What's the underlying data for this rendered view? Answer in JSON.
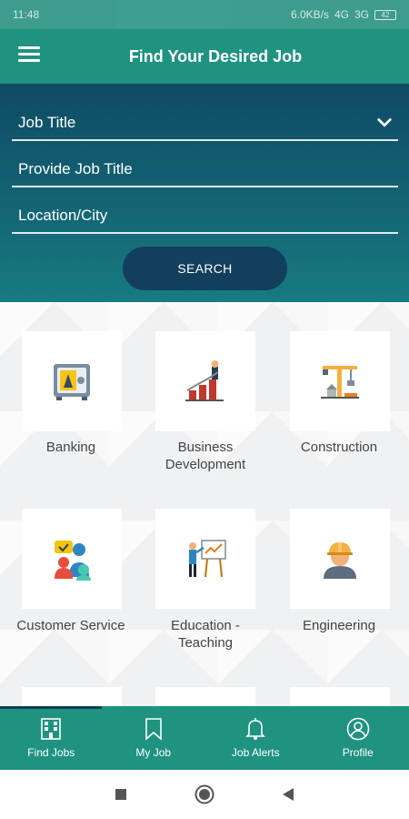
{
  "status_bar": {
    "time": "11:48",
    "network": "6.0KB/s",
    "signal": "4G",
    "carrier": "3G",
    "battery": "42"
  },
  "app_bar": {
    "title": "Find Your Desired Job"
  },
  "search": {
    "job_title_label": "Job Title",
    "provide_job_title_label": "Provide Job Title",
    "location_label": "Location/City",
    "search_button": "SEARCH"
  },
  "categories": [
    {
      "label": "Banking",
      "icon": "vault-icon"
    },
    {
      "label": "Business\nDevelopment",
      "icon": "growth-chart-icon"
    },
    {
      "label": "Construction",
      "icon": "crane-icon"
    },
    {
      "label": "Customer Service",
      "icon": "support-chat-icon"
    },
    {
      "label": "Education -\nTeaching",
      "icon": "teacher-board-icon"
    },
    {
      "label": "Engineering",
      "icon": "engineer-helmet-icon"
    }
  ],
  "bottom_nav": [
    {
      "label": "Find Jobs",
      "icon": "building-icon",
      "active": true
    },
    {
      "label": "My Job",
      "icon": "bookmark-icon"
    },
    {
      "label": "Job Alerts",
      "icon": "bell-icon"
    },
    {
      "label": "Profile",
      "icon": "user-icon"
    }
  ],
  "colors": {
    "primary": "#1f9280",
    "dark_blue": "#0f4a64",
    "button": "#123f5c"
  }
}
